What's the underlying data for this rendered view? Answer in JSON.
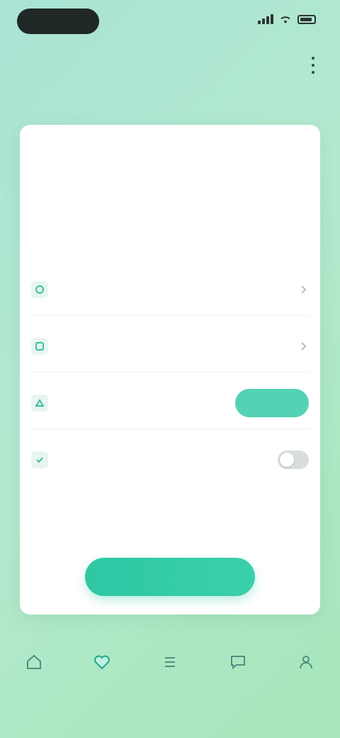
{
  "status_bar": {
    "time": ""
  },
  "header": {
    "title": ""
  },
  "sub_row": {
    "left": "",
    "right": ""
  },
  "card": {
    "title": "",
    "description": "",
    "rows": [
      {
        "label": "",
        "value": ""
      },
      {
        "label": "",
        "value": ""
      },
      {
        "label": "",
        "hint": "",
        "button": ""
      },
      {
        "label": "",
        "value": ""
      }
    ],
    "footnote": "",
    "primary_button": ""
  },
  "bottom_nav": {
    "items": [
      {
        "label": "",
        "icon": "home-icon"
      },
      {
        "label": "",
        "icon": "heart-icon"
      },
      {
        "label": "",
        "icon": "list-icon"
      },
      {
        "label": "",
        "icon": "chat-icon"
      },
      {
        "label": "",
        "icon": "user-icon"
      }
    ],
    "active_index": 1
  },
  "colors": {
    "accent": "#2fc7a4",
    "pill": "#54d2b6",
    "background_start": "#a9e3d4",
    "background_end": "#a6e6b9"
  }
}
